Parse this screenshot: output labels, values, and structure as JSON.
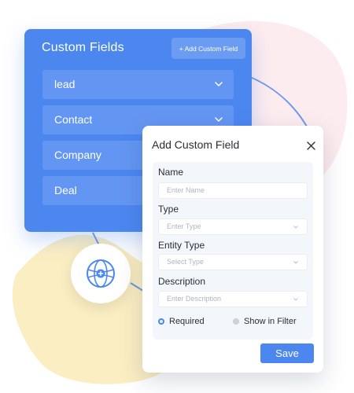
{
  "colors": {
    "primary": "#4c87f0",
    "decor_pink": "#fdecef",
    "decor_yellow": "#fbeec2",
    "connector": "#6d98f0"
  },
  "custom_fields_panel": {
    "title": "Custom Fields",
    "add_button_label": "+ Add Custom Field",
    "items": [
      {
        "label": "lead"
      },
      {
        "label": "Contact"
      },
      {
        "label": "Company"
      },
      {
        "label": "Deal"
      }
    ]
  },
  "badge": {
    "icon": "globe-icon"
  },
  "dialog": {
    "title": "Add Custom Field",
    "close_icon": "close-icon",
    "fields": {
      "name": {
        "label": "Name",
        "placeholder": "Enter Name"
      },
      "type": {
        "label": "Type",
        "placeholder": "Enter Type"
      },
      "entity_type": {
        "label": "Entity Type",
        "placeholder": "Select Type"
      },
      "description": {
        "label": "Description",
        "placeholder": "Enter Description"
      }
    },
    "options": {
      "required": {
        "label": "Required",
        "selected": true
      },
      "show_in_filter": {
        "label": "Show in Filter",
        "selected": false
      }
    },
    "save_label": "Save"
  }
}
